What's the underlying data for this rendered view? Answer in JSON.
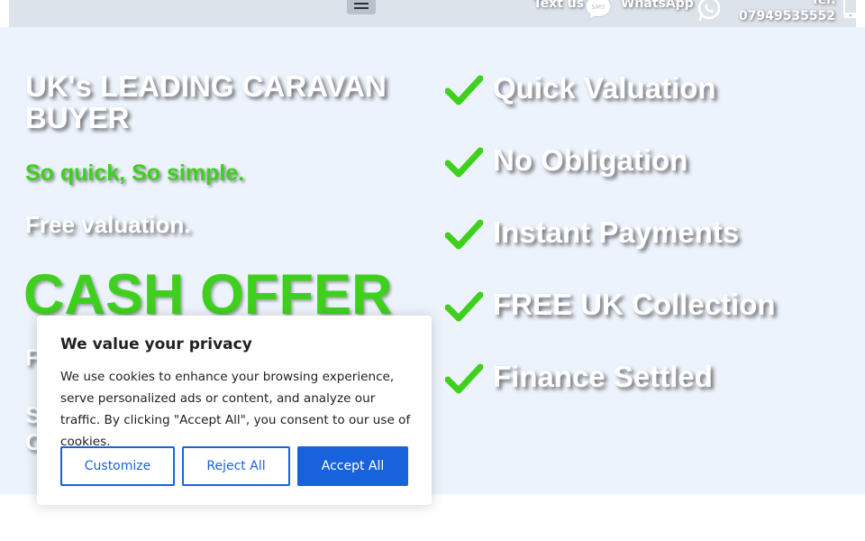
{
  "topbar": {
    "text_us": "Text us",
    "sms_icon_text": "SMS",
    "whatsapp": "WhatsApp",
    "tel_label": "Tel:",
    "tel_number": "07949535552"
  },
  "hero": {
    "headline": "UK's LEADING CARAVAN BUYER",
    "tagline": "So quick, So simple.",
    "free_valuation": "Free valuation.",
    "cash_offer": "CASH OFFER",
    "hidden_line_1": "F",
    "hidden_line_2": "S",
    "hidden_line_3": "C"
  },
  "features": [
    {
      "label": "Quick Valuation"
    },
    {
      "label": "No Obligation"
    },
    {
      "label": "Instant Payments"
    },
    {
      "label": "FREE UK Collection"
    },
    {
      "label": "Finance Settled"
    }
  ],
  "colors": {
    "accent_green": "#3fd01e",
    "cookie_blue": "#1863dc",
    "hero_bg": "#edf3fc"
  },
  "cookie_banner": {
    "title": "We value your privacy",
    "body": "We use cookies to enhance your browsing experience, serve personalized ads or content, and analyze our traffic. By clicking \"Accept All\", you consent to our use of cookies.",
    "customize": "Customize",
    "reject": "Reject All",
    "accept": "Accept All"
  }
}
